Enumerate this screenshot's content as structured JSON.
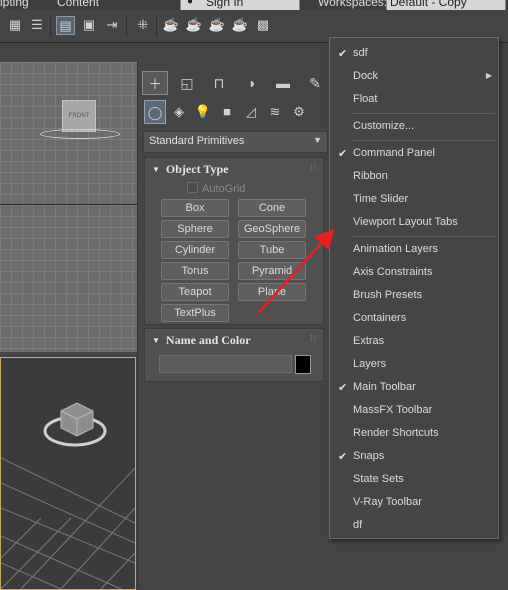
{
  "menubar": {
    "items": [
      "ipting",
      "Content"
    ],
    "sign_in": "Sign In",
    "workspaces_label": "Workspaces:",
    "workspace_value": "Default - Copy"
  },
  "viewports": {
    "top_label": "FRONT",
    "active_border_color": "#c9a85a"
  },
  "command_panel": {
    "tabs": [
      "create-icon",
      "modify-icon",
      "hierarchy-icon",
      "motion-icon",
      "display-icon",
      "utilities-icon"
    ],
    "subcategories": [
      "geometry-icon",
      "shapes-icon",
      "lights-icon",
      "cameras-icon",
      "helpers-icon",
      "spacewarps-icon",
      "systems-icon"
    ],
    "category_value": "Standard Primitives",
    "object_type": {
      "title": "Object Type",
      "autogrid": "AutoGrid",
      "buttons": [
        "Box",
        "Cone",
        "Sphere",
        "GeoSphere",
        "Cylinder",
        "Tube",
        "Torus",
        "Pyramid",
        "Teapot",
        "Plane",
        "TextPlus"
      ]
    },
    "name_and_color": {
      "title": "Name and Color",
      "name_value": "",
      "color": "#000000"
    }
  },
  "context_menu": {
    "items": [
      {
        "label": "sdf",
        "checked": true
      },
      {
        "label": "Dock",
        "checked": false,
        "submenu": true
      },
      {
        "label": "Float",
        "checked": false
      },
      {
        "label": "Customize...",
        "checked": false
      },
      {
        "label": "Command Panel",
        "checked": true
      },
      {
        "label": "Ribbon",
        "checked": false
      },
      {
        "label": "Time Slider",
        "checked": false
      },
      {
        "label": "Viewport Layout Tabs",
        "checked": false
      },
      {
        "label": "Animation Layers",
        "checked": false
      },
      {
        "label": "Axis Constraints",
        "checked": false
      },
      {
        "label": "Brush Presets",
        "checked": false
      },
      {
        "label": "Containers",
        "checked": false
      },
      {
        "label": "Extras",
        "checked": false
      },
      {
        "label": "Layers",
        "checked": false
      },
      {
        "label": "Main Toolbar",
        "checked": true
      },
      {
        "label": "MassFX Toolbar",
        "checked": false
      },
      {
        "label": "Render Shortcuts",
        "checked": false
      },
      {
        "label": "Snaps",
        "checked": true
      },
      {
        "label": "State Sets",
        "checked": false
      },
      {
        "label": "V-Ray Toolbar",
        "checked": false
      },
      {
        "label": "df",
        "checked": false
      }
    ],
    "check_glyph": "✔",
    "arrow_color": "#e8201c"
  }
}
